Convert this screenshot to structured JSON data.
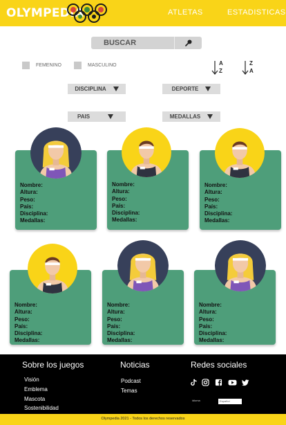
{
  "header": {
    "logo": "OLYMPEDIA",
    "nav": [
      "ATLETAS",
      "ESTADISTICAS"
    ],
    "colors": {
      "bar": "#f9d418",
      "text": "#ffffff"
    }
  },
  "search": {
    "label": "BUSCAR",
    "icon": "magnifier-icon"
  },
  "filters": {
    "checkboxes": [
      "FEMENINO",
      "MASCULINO"
    ],
    "sort_asc": [
      "A",
      "Z"
    ],
    "sort_desc": [
      "Z",
      "A"
    ],
    "dropdowns": [
      "DISCIPLINA",
      "DEPORTE",
      "PAIS",
      "MEDALLAS"
    ]
  },
  "card": {
    "fields": [
      "Nombre:",
      "Altura:",
      "Peso:",
      "País:",
      "Disciplina:",
      "Medallas:"
    ],
    "color": "#4e9e7a"
  },
  "athletes": [
    {
      "gender": "female",
      "hair": "blond",
      "background": "navy"
    },
    {
      "gender": "male",
      "hair": "brown",
      "background": "yellow"
    },
    {
      "gender": "male",
      "hair": "brown",
      "background": "yellow"
    },
    {
      "gender": "male",
      "hair": "brown",
      "background": "yellow"
    },
    {
      "gender": "female",
      "hair": "blond",
      "background": "navy"
    },
    {
      "gender": "female",
      "hair": "blond",
      "background": "navy"
    }
  ],
  "footer": {
    "about": {
      "title": "Sobre los juegos",
      "links": [
        "Visión",
        "Emblema",
        "Mascota",
        "Sostenibilidad"
      ]
    },
    "news": {
      "title": "Noticias",
      "links": [
        "Podcast",
        "Temas"
      ]
    },
    "social": {
      "title": "Redes sociales",
      "icons": [
        "tiktok-icon",
        "instagram-icon",
        "facebook-icon",
        "youtube-icon",
        "twitter-icon"
      ]
    },
    "language_label": "idioma",
    "language_value": "Español",
    "copyright": "Olympedia 2021 - Todos los derechos reservados"
  }
}
